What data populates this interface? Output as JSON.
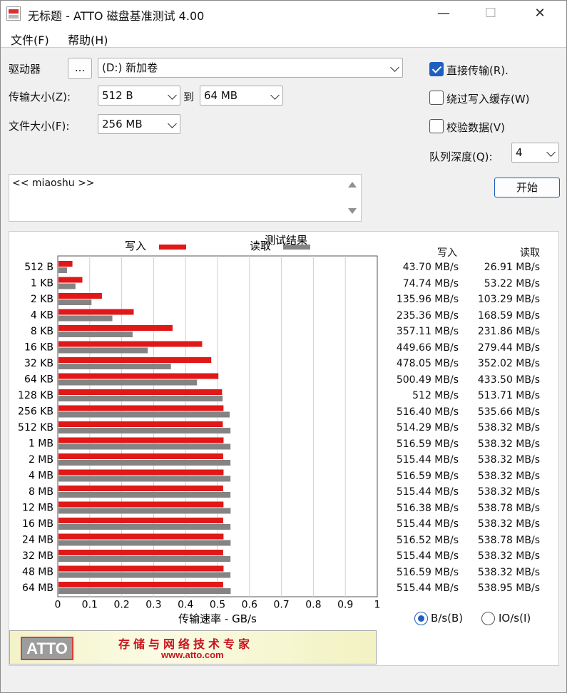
{
  "window": {
    "title": "无标题 - ATTO 磁盘基准测试 4.00",
    "minimize": "—",
    "maximize": "☐",
    "close": "✕"
  },
  "menu": [
    "文件(F)",
    "帮助(H)"
  ],
  "settings": {
    "drive_label": "驱动器",
    "browse_label": "...",
    "drive_value": "(D:) 新加卷",
    "transfer_label": "传输大小(Z):",
    "transfer_from": "512 B",
    "to_label": "到",
    "transfer_to": "64 MB",
    "filesize_label": "文件大小(F):",
    "filesize_value": "256 MB",
    "direct_io_label": "直接传输(R).",
    "direct_io_checked": true,
    "bypass_cache_label": "绕过写入缓存(W)",
    "bypass_cache_checked": false,
    "verify_label": "校验数据(V)",
    "verify_checked": false,
    "queue_label": "队列深度(Q):",
    "queue_value": "4",
    "start_label": "开始"
  },
  "description": {
    "text": "<< miaoshu >>"
  },
  "results": {
    "title": "测试结果",
    "write_legend": "写入",
    "read_legend": "读取",
    "write_header": "写入",
    "read_header": "读取",
    "colors": {
      "write": "#e01818",
      "read": "#848484"
    },
    "unit_bps_label": "B/s(B)",
    "unit_ios_label": "IO/s(I)",
    "unit_selected": "B/s",
    "rows": [
      {
        "size": "512 B",
        "write": "43.70 MB/s",
        "read": "26.91 MB/s"
      },
      {
        "size": "1 KB",
        "write": "74.74 MB/s",
        "read": "53.22 MB/s"
      },
      {
        "size": "2 KB",
        "write": "135.96 MB/s",
        "read": "103.29 MB/s"
      },
      {
        "size": "4 KB",
        "write": "235.36 MB/s",
        "read": "168.59 MB/s"
      },
      {
        "size": "8 KB",
        "write": "357.11 MB/s",
        "read": "231.86 MB/s"
      },
      {
        "size": "16 KB",
        "write": "449.66 MB/s",
        "read": "279.44 MB/s"
      },
      {
        "size": "32 KB",
        "write": "478.05 MB/s",
        "read": "352.02 MB/s"
      },
      {
        "size": "64 KB",
        "write": "500.49 MB/s",
        "read": "433.50 MB/s"
      },
      {
        "size": "128 KB",
        "write": "512 MB/s",
        "read": "513.71 MB/s"
      },
      {
        "size": "256 KB",
        "write": "516.40 MB/s",
        "read": "535.66 MB/s"
      },
      {
        "size": "512 KB",
        "write": "514.29 MB/s",
        "read": "538.32 MB/s"
      },
      {
        "size": "1 MB",
        "write": "516.59 MB/s",
        "read": "538.32 MB/s"
      },
      {
        "size": "2 MB",
        "write": "515.44 MB/s",
        "read": "538.32 MB/s"
      },
      {
        "size": "4 MB",
        "write": "516.59 MB/s",
        "read": "538.32 MB/s"
      },
      {
        "size": "8 MB",
        "write": "515.44 MB/s",
        "read": "538.32 MB/s"
      },
      {
        "size": "12 MB",
        "write": "516.38 MB/s",
        "read": "538.78 MB/s"
      },
      {
        "size": "16 MB",
        "write": "515.44 MB/s",
        "read": "538.32 MB/s"
      },
      {
        "size": "24 MB",
        "write": "516.52 MB/s",
        "read": "538.78 MB/s"
      },
      {
        "size": "32 MB",
        "write": "515.44 MB/s",
        "read": "538.32 MB/s"
      },
      {
        "size": "48 MB",
        "write": "516.59 MB/s",
        "read": "538.32 MB/s"
      },
      {
        "size": "64 MB",
        "write": "515.44 MB/s",
        "read": "538.95 MB/s"
      }
    ]
  },
  "chart_data": {
    "type": "bar",
    "orientation": "horizontal",
    "title": "测试结果",
    "xlabel": "传输速率 - GB/s",
    "xlim": [
      0,
      1
    ],
    "xticks": [
      "0",
      "0.1",
      "0.2",
      "0.3",
      "0.4",
      "0.5",
      "0.6",
      "0.7",
      "0.8",
      "0.9",
      "1"
    ],
    "grid": true,
    "categories": [
      "512 B",
      "1 KB",
      "2 KB",
      "4 KB",
      "8 KB",
      "16 KB",
      "32 KB",
      "64 KB",
      "128 KB",
      "256 KB",
      "512 KB",
      "1 MB",
      "2 MB",
      "4 MB",
      "8 MB",
      "12 MB",
      "16 MB",
      "24 MB",
      "32 MB",
      "48 MB",
      "64 MB"
    ],
    "series": [
      {
        "name": "写入",
        "values": [
          0.0437,
          0.0747,
          0.136,
          0.2354,
          0.3571,
          0.4497,
          0.4781,
          0.5005,
          0.512,
          0.5164,
          0.5143,
          0.5166,
          0.5154,
          0.5166,
          0.5154,
          0.5164,
          0.5154,
          0.5165,
          0.5154,
          0.5166,
          0.5154
        ]
      },
      {
        "name": "读取",
        "values": [
          0.0269,
          0.0532,
          0.1033,
          0.1686,
          0.2319,
          0.2794,
          0.352,
          0.4335,
          0.5137,
          0.5357,
          0.5383,
          0.5383,
          0.5383,
          0.5383,
          0.5383,
          0.5388,
          0.5383,
          0.5388,
          0.5383,
          0.5383,
          0.539
        ]
      }
    ]
  },
  "banner": {
    "logo": "ATTO",
    "slogan": "存储与网络技术专家",
    "url": "www.atto.com"
  }
}
